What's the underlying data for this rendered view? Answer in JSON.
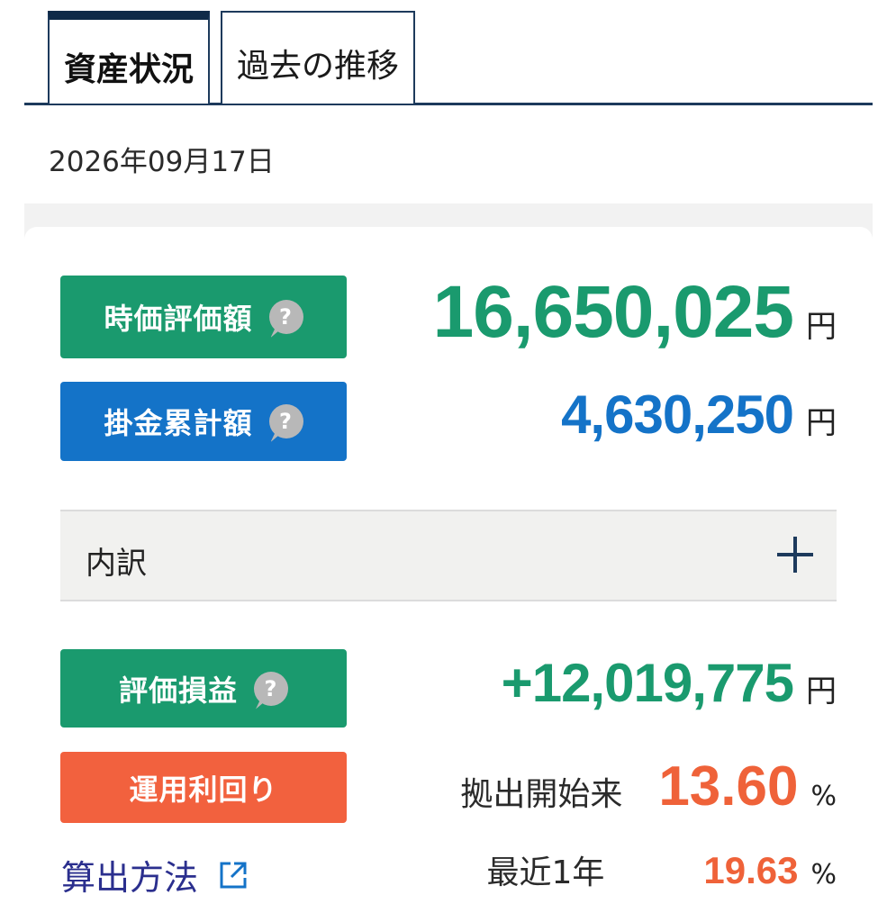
{
  "tabs": [
    {
      "label": "資産状況",
      "active": true
    },
    {
      "label": "過去の推移",
      "active": false
    }
  ],
  "date": "2026年09月17日",
  "market_value": {
    "label": "時価評価額",
    "amount": "16,650,025",
    "unit": "円",
    "color": "#1a9a6e"
  },
  "contribution_total": {
    "label": "掛金累計額",
    "amount": "4,630,250",
    "unit": "円",
    "color": "#1473c8"
  },
  "breakdown": {
    "label": "内訳"
  },
  "gain_loss": {
    "label": "評価損益",
    "amount": "+12,019,775",
    "unit": "円",
    "color": "#1a9a6e"
  },
  "yield": {
    "label": "運用利回り",
    "rows": [
      {
        "period": "拠出開始来",
        "rate": "13.60",
        "unit": "%"
      },
      {
        "period": "最近1年",
        "rate": "19.63",
        "unit": "%"
      }
    ],
    "color": "#ef6239"
  },
  "calc_method": {
    "label": "算出方法"
  },
  "help_icon_text": "?"
}
